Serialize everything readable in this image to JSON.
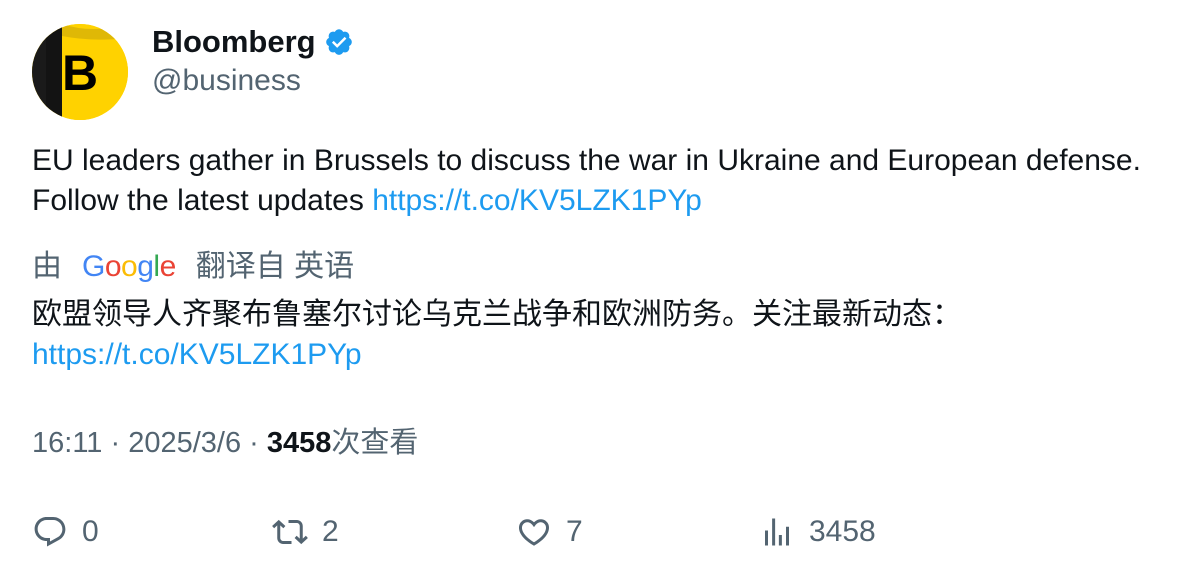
{
  "author": {
    "display_name": "Bloomberg",
    "handle": "@business",
    "avatar_letter": "B",
    "avatar_color": "#ffd200",
    "verified": true,
    "verified_color": "#1d9bf0"
  },
  "tweet": {
    "text": "EU leaders gather in Brussels to discuss the war in Ukraine and European defense. Follow the latest updates ",
    "link": "https://t.co/KV5LZK1PYp"
  },
  "translation": {
    "prefix": "由",
    "provider": "Google",
    "suffix": "翻译自 英语",
    "text": "欧盟领导人齐聚布鲁塞尔讨论乌克兰战争和欧洲防务。关注最新动态：",
    "link": "https://t.co/KV5LZK1PYp"
  },
  "meta": {
    "time": "16:11",
    "separator": "·",
    "date": "2025/3/6",
    "views_count": "3458",
    "views_label": "次查看"
  },
  "actions": {
    "replies": "0",
    "retweets": "2",
    "likes": "7",
    "views": "3458"
  },
  "colors": {
    "link": "#1d9bf0",
    "secondary_text": "#536471",
    "primary_text": "#0f1419",
    "google_blue": "#4285f4",
    "google_red": "#ea4335",
    "google_yellow": "#fbbc05",
    "google_green": "#34a853"
  },
  "icons": {
    "reply": "reply-icon",
    "retweet": "retweet-icon",
    "like": "heart-icon",
    "views": "bar-chart-icon",
    "verified": "verified-badge-icon"
  }
}
